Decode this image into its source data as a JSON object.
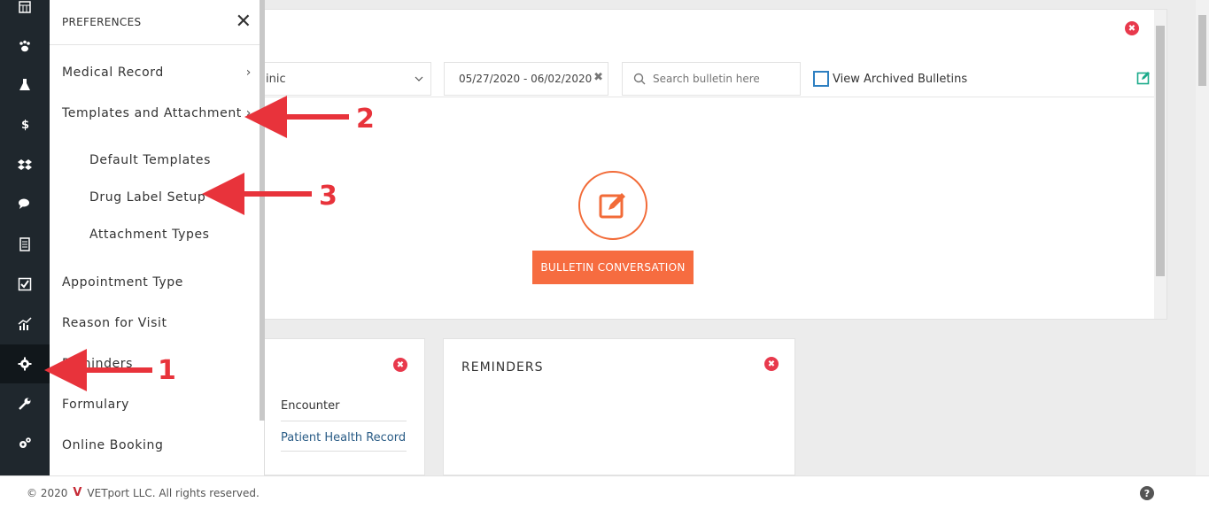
{
  "flyout": {
    "title": "PREFERENCES",
    "close_glyph": "✕",
    "items": [
      {
        "label": "Medical Record",
        "chevron": "›"
      },
      {
        "label": "Templates and Attachment",
        "chevron": "›"
      },
      {
        "label": "Default Templates"
      },
      {
        "label": "Drug Label Setup"
      },
      {
        "label": "Attachment Types"
      },
      {
        "label": "Appointment Type"
      },
      {
        "label": "Reason for Visit"
      },
      {
        "label": "Reminders"
      },
      {
        "label": "Formulary"
      },
      {
        "label": "Online Booking"
      }
    ]
  },
  "rail": {
    "icons": [
      "calendar-icon",
      "paw-icon",
      "flask-icon",
      "dollar-icon",
      "dropbox-icon",
      "chat-icon",
      "receipt-icon",
      "checkbox-icon",
      "chart-icon",
      "gear-icon",
      "wrench-icon",
      "gears-icon"
    ],
    "active_icon": "gear-icon"
  },
  "bulletin": {
    "clinic_value": "inic",
    "date_range": "05/27/2020 - 06/02/2020",
    "date_clear": "✖",
    "search_placeholder": "Search bulletin here",
    "archived_label": "View Archived Bulletins",
    "button_label": "BULLETIN CONVERSATION",
    "close_glyph": "✖"
  },
  "encounter_card": {
    "header": "Encounter",
    "link": "Patient Health Record"
  },
  "reminders_card": {
    "title": "REMINDERS"
  },
  "footer": {
    "copyright": "© 2020",
    "logo_glyph": "V",
    "text": "VETport LLC. All rights reserved.",
    "help_glyph": "?"
  },
  "annotations": [
    "1",
    "2",
    "3"
  ],
  "colors": {
    "accent": "#f66c40",
    "close_red": "#e8394c",
    "rail_bg": "#1f272d",
    "link": "#2a5c86",
    "annotation": "#e8333b"
  }
}
